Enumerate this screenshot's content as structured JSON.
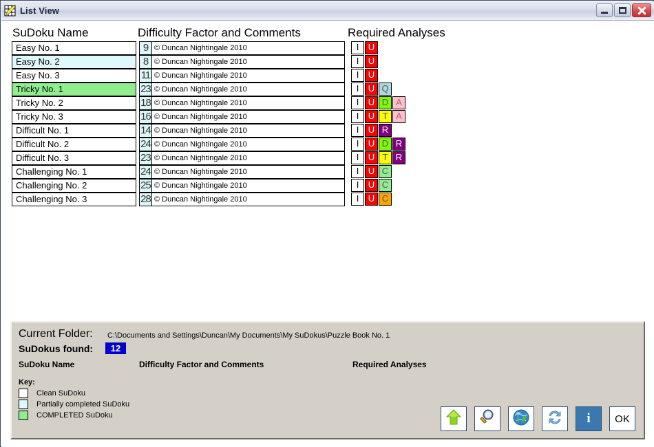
{
  "window": {
    "title": "List View",
    "icon": "sudoku-grid-pencil-icon",
    "controls": {
      "minimize": "minimize-button",
      "maximize": "maximize-button",
      "close": "close-button"
    }
  },
  "list": {
    "headers": {
      "name": "SuDoku Name",
      "difficulty": "Difficulty Factor and Comments",
      "analyses": "Required Analyses"
    },
    "rows": [
      {
        "name": "Easy No. 1",
        "state": "clean",
        "difficulty": "9",
        "comment": "© Duncan Nightingale 2010",
        "analyses": [
          "I",
          "U"
        ]
      },
      {
        "name": "Easy No. 2",
        "state": "partial",
        "difficulty": "8",
        "comment": "© Duncan Nightingale 2010",
        "analyses": [
          "I",
          "U"
        ]
      },
      {
        "name": "Easy No. 3",
        "state": "clean",
        "difficulty": "11",
        "comment": "© Duncan Nightingale 2010",
        "analyses": [
          "I",
          "U"
        ]
      },
      {
        "name": "Tricky No. 1",
        "state": "completed",
        "difficulty": "23",
        "comment": "© Duncan Nightingale 2010",
        "analyses": [
          "I",
          "U",
          "Q"
        ]
      },
      {
        "name": "Tricky No. 2",
        "state": "clean",
        "difficulty": "18",
        "comment": "© Duncan Nightingale 2010",
        "analyses": [
          "I",
          "U",
          "D",
          "A"
        ]
      },
      {
        "name": "Tricky No. 3",
        "state": "clean",
        "difficulty": "16",
        "comment": "© Duncan Nightingale 2010",
        "analyses": [
          "I",
          "U",
          "T",
          "A"
        ]
      },
      {
        "name": "Difficult No. 1",
        "state": "clean",
        "difficulty": "14",
        "comment": "© Duncan Nightingale 2010",
        "analyses": [
          "I",
          "U",
          "R"
        ]
      },
      {
        "name": "Difficult No. 2",
        "state": "clean",
        "difficulty": "24",
        "comment": "© Duncan Nightingale 2010",
        "analyses": [
          "I",
          "U",
          "D",
          "R"
        ]
      },
      {
        "name": "Difficult No. 3",
        "state": "clean",
        "difficulty": "23",
        "comment": "© Duncan Nightingale 2010",
        "analyses": [
          "I",
          "U",
          "T",
          "R"
        ]
      },
      {
        "name": "Challenging No. 1",
        "state": "clean",
        "difficulty": "24",
        "comment": "© Duncan Nightingale 2010",
        "analyses": [
          "I",
          "U",
          "C"
        ]
      },
      {
        "name": "Challenging No. 2",
        "state": "clean",
        "difficulty": "25",
        "comment": "© Duncan Nightingale 2010",
        "analyses": [
          "I",
          "U",
          "C"
        ]
      },
      {
        "name": "Challenging No. 3",
        "state": "clean",
        "difficulty": "28",
        "comment": "© Duncan Nightingale 2010",
        "analyses": [
          "I",
          "U",
          "C2"
        ]
      }
    ]
  },
  "badge_styles": {
    "I": {
      "label": "I",
      "bg": "#ffffff",
      "fg": "#000000"
    },
    "U": {
      "label": "U",
      "bg": "#ff0000",
      "fg": "#ffffff"
    },
    "Q": {
      "label": "Q",
      "bg": "#add8e6",
      "fg": "#555555"
    },
    "D": {
      "label": "D",
      "bg": "#7cfc00",
      "fg": "#555555"
    },
    "T": {
      "label": "T",
      "bg": "#ffff00",
      "fg": "#555555"
    },
    "A": {
      "label": "A",
      "bg": "#ffc0cb",
      "fg": "#aa6677"
    },
    "R": {
      "label": "R",
      "bg": "#800080",
      "fg": "#ffffff"
    },
    "C": {
      "label": "C",
      "bg": "#90ee90",
      "fg": "#555555"
    },
    "C2": {
      "label": "C",
      "bg": "#ffa500",
      "fg": "#555555"
    }
  },
  "row_states": {
    "clean": "#ffffff",
    "partial": "#e0f8fb",
    "completed": "#90ee90"
  },
  "panel": {
    "current_folder_label": "Current Folder:",
    "current_folder_path": "C:\\Documents and Settings\\Duncan\\My Documents\\My SuDokus\\Puzzle Book No. 1",
    "found_label": "SuDokus found:",
    "found_count": "12",
    "sub_headers": {
      "name": "SuDoku Name",
      "difficulty": "Difficulty Factor and Comments",
      "analyses": "Required Analyses"
    },
    "key_label": "Key:",
    "key_items": [
      {
        "color": "#ffffff",
        "text": "Clean SuDoku"
      },
      {
        "color": "#e0f8fb",
        "text": "Partially completed SuDoku"
      },
      {
        "color": "#90ee90",
        "text": "COMPLETED SuDoku"
      }
    ]
  },
  "actions": [
    {
      "name": "up-folder-button",
      "icon": "green-up-arrow-icon",
      "label": ""
    },
    {
      "name": "search-button",
      "icon": "magnifier-icon",
      "label": ""
    },
    {
      "name": "web-button",
      "icon": "globe-icon",
      "label": ""
    },
    {
      "name": "refresh-button",
      "icon": "refresh-icon",
      "label": ""
    },
    {
      "name": "info-button",
      "icon": "info-i-icon",
      "label": "i"
    },
    {
      "name": "ok-button",
      "icon": "",
      "label": "OK"
    }
  ],
  "colors": {
    "window_border": "#3c4a6e",
    "panel_bg": "#d4d0c8",
    "count_badge_bg": "#0000c8",
    "accent_blue": "#3b78b0"
  }
}
